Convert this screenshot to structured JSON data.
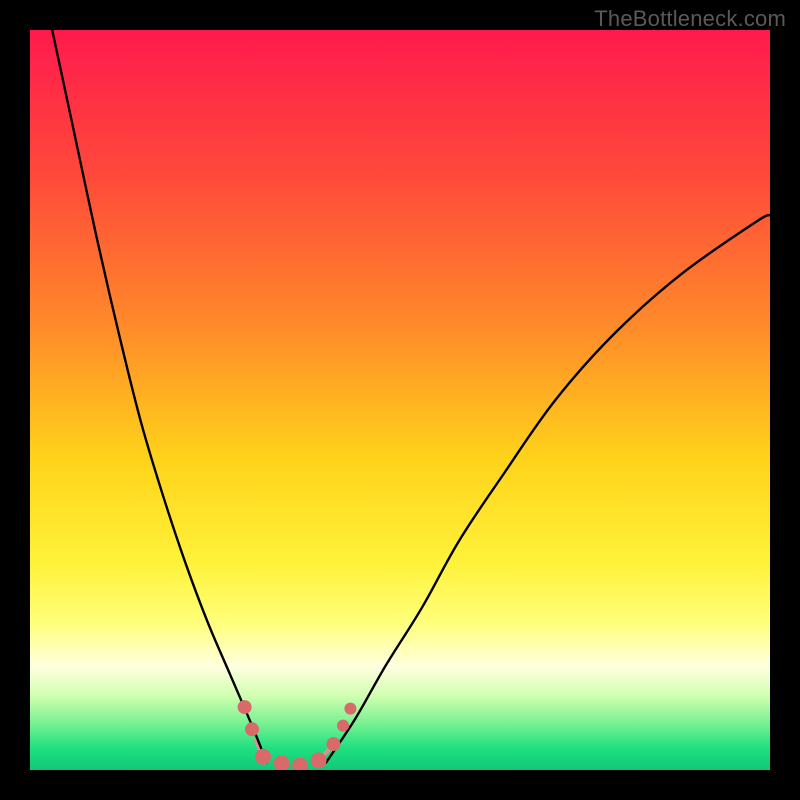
{
  "watermark": "TheBottleneck.com",
  "chart_data": {
    "type": "line",
    "title": "",
    "xlabel": "",
    "ylabel": "",
    "xlim": [
      0,
      100
    ],
    "ylim": [
      0,
      100
    ],
    "grid": false,
    "legend": false,
    "background": {
      "type": "gradient",
      "stops": [
        {
          "pos": 0.0,
          "color": "#ff1a4d"
        },
        {
          "pos": 0.2,
          "color": "#ff4a3a"
        },
        {
          "pos": 0.4,
          "color": "#ff8a2a"
        },
        {
          "pos": 0.58,
          "color": "#ffd31a"
        },
        {
          "pos": 0.72,
          "color": "#fff23a"
        },
        {
          "pos": 0.8,
          "color": "#ffff7a"
        },
        {
          "pos": 0.86,
          "color": "#ffffe0"
        },
        {
          "pos": 0.9,
          "color": "#d0ffb0"
        },
        {
          "pos": 0.94,
          "color": "#70f090"
        },
        {
          "pos": 0.97,
          "color": "#20e080"
        },
        {
          "pos": 1.0,
          "color": "#10c878"
        }
      ]
    },
    "series": [
      {
        "name": "left-curve",
        "x": [
          3,
          6,
          9,
          12,
          15,
          18,
          21,
          24,
          27,
          30,
          32
        ],
        "y": [
          100,
          86,
          72,
          59,
          47,
          37,
          28,
          20,
          13,
          6,
          1
        ]
      },
      {
        "name": "right-curve",
        "x": [
          40,
          44,
          48,
          53,
          58,
          64,
          71,
          79,
          88,
          98,
          100
        ],
        "y": [
          1,
          7,
          14,
          22,
          31,
          40,
          50,
          59,
          67,
          74,
          75
        ]
      }
    ],
    "markers": {
      "name": "bottleneck-points",
      "color": "#d86a6a",
      "thin_color": "#e09090",
      "points": [
        {
          "x": 29.0,
          "y": 8.5,
          "r": 7
        },
        {
          "x": 30.0,
          "y": 5.5,
          "r": 7
        },
        {
          "x": 31.5,
          "y": 1.8,
          "r": 8
        },
        {
          "x": 34.0,
          "y": 0.9,
          "r": 8
        },
        {
          "x": 36.5,
          "y": 0.6,
          "r": 8
        },
        {
          "x": 39.0,
          "y": 1.3,
          "r": 8
        },
        {
          "x": 41.0,
          "y": 3.5,
          "r": 7
        },
        {
          "x": 42.3,
          "y": 6.0,
          "r": 6
        },
        {
          "x": 43.3,
          "y": 8.3,
          "r": 6
        }
      ],
      "thin_segments": [
        {
          "x1": 30.5,
          "y1": 4.0,
          "x2": 31.5,
          "y2": 1.8
        },
        {
          "x1": 39.5,
          "y1": 1.8,
          "x2": 41.0,
          "y2": 3.5
        }
      ]
    }
  }
}
